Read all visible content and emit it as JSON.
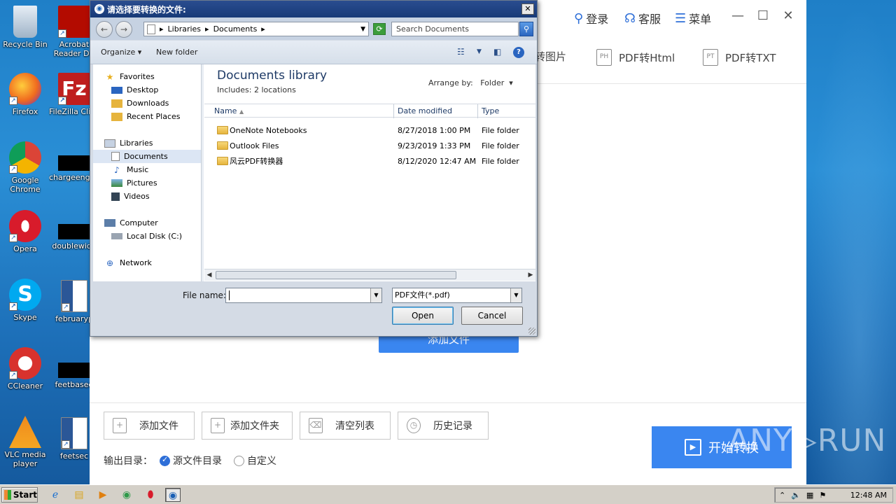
{
  "desktop": {
    "icons": [
      {
        "label": "Recycle Bin",
        "icon": "recycle-bin-icon",
        "color": "#c8d8ea"
      },
      {
        "label": "Acrobat Reader DC",
        "icon": "acrobat-icon",
        "color": "#b30b00"
      },
      {
        "label": "Firefox",
        "icon": "firefox-icon",
        "color": "#f06b1f"
      },
      {
        "label": "FileZilla Client",
        "icon": "filezilla-icon",
        "color": "#bf1e1e"
      },
      {
        "label": "Google Chrome",
        "icon": "chrome-icon",
        "color": "#2f9a4a"
      },
      {
        "label": "chargeengine",
        "icon": "file-icon",
        "color": "#000000"
      },
      {
        "label": "Opera",
        "icon": "opera-icon",
        "color": "#d81b2b"
      },
      {
        "label": "doublewide",
        "icon": "file-icon",
        "color": "#000000"
      },
      {
        "label": "Skype",
        "icon": "skype-icon",
        "color": "#00a9f0"
      },
      {
        "label": "februaryp",
        "icon": "word-icon",
        "color": "#2b5797"
      },
      {
        "label": "CCleaner",
        "icon": "ccleaner-icon",
        "color": "#d8322d"
      },
      {
        "label": "feetbased",
        "icon": "file-icon",
        "color": "#000000"
      },
      {
        "label": "VLC media player",
        "icon": "vlc-icon",
        "color": "#f08a1c"
      },
      {
        "label": "feetsec",
        "icon": "word-icon",
        "color": "#2b5797"
      }
    ]
  },
  "app": {
    "top": {
      "login": "登录",
      "service": "客服",
      "menu": "菜单"
    },
    "tabs": [
      {
        "label": "转图片",
        "icon": "PDF"
      },
      {
        "label": "PDF转Html",
        "icon": "PH"
      },
      {
        "label": "PDF转TXT",
        "icon": "PT"
      }
    ],
    "center_button": "添加文件",
    "bottom": {
      "add_file": "添加文件",
      "add_folder": "添加文件夹",
      "clear_list": "清空列表",
      "history": "历史记录",
      "output_label": "输出目录：",
      "opt_source": "源文件目录",
      "opt_custom": "自定义",
      "start": "开始转换"
    },
    "accent_color": "#3a86f0"
  },
  "dialog": {
    "title": "请选择要转换的文件:",
    "address": {
      "root": "Libraries",
      "current": "Documents"
    },
    "search_placeholder": "Search Documents",
    "toolbar": {
      "organize": "Organize",
      "new_folder": "New folder"
    },
    "nav": {
      "favorites": "Favorites",
      "desktop": "Desktop",
      "downloads": "Downloads",
      "recent": "Recent Places",
      "libraries": "Libraries",
      "documents": "Documents",
      "music": "Music",
      "pictures": "Pictures",
      "videos": "Videos",
      "computer": "Computer",
      "local_disk": "Local Disk (C:)",
      "network": "Network"
    },
    "library_title": "Documents library",
    "library_sub": "Includes:  2 locations",
    "arrange_label": "Arrange by:",
    "arrange_value": "Folder",
    "columns": {
      "name": "Name",
      "date": "Date modified",
      "type": "Type"
    },
    "files": [
      {
        "name": "OneNote Notebooks",
        "date": "8/27/2018 1:00 PM",
        "type": "File folder"
      },
      {
        "name": "Outlook Files",
        "date": "9/23/2019 1:33 PM",
        "type": "File folder"
      },
      {
        "name": "风云PDF转换器",
        "date": "8/12/2020 12:47 AM",
        "type": "File folder"
      }
    ],
    "file_name_label": "File name:",
    "file_name_value": "",
    "file_type": "PDF文件(*.pdf)",
    "open": "Open",
    "cancel": "Cancel"
  },
  "taskbar": {
    "start": "Start",
    "clock": "12:48 AM"
  },
  "watermark": "ANY▷RUN"
}
